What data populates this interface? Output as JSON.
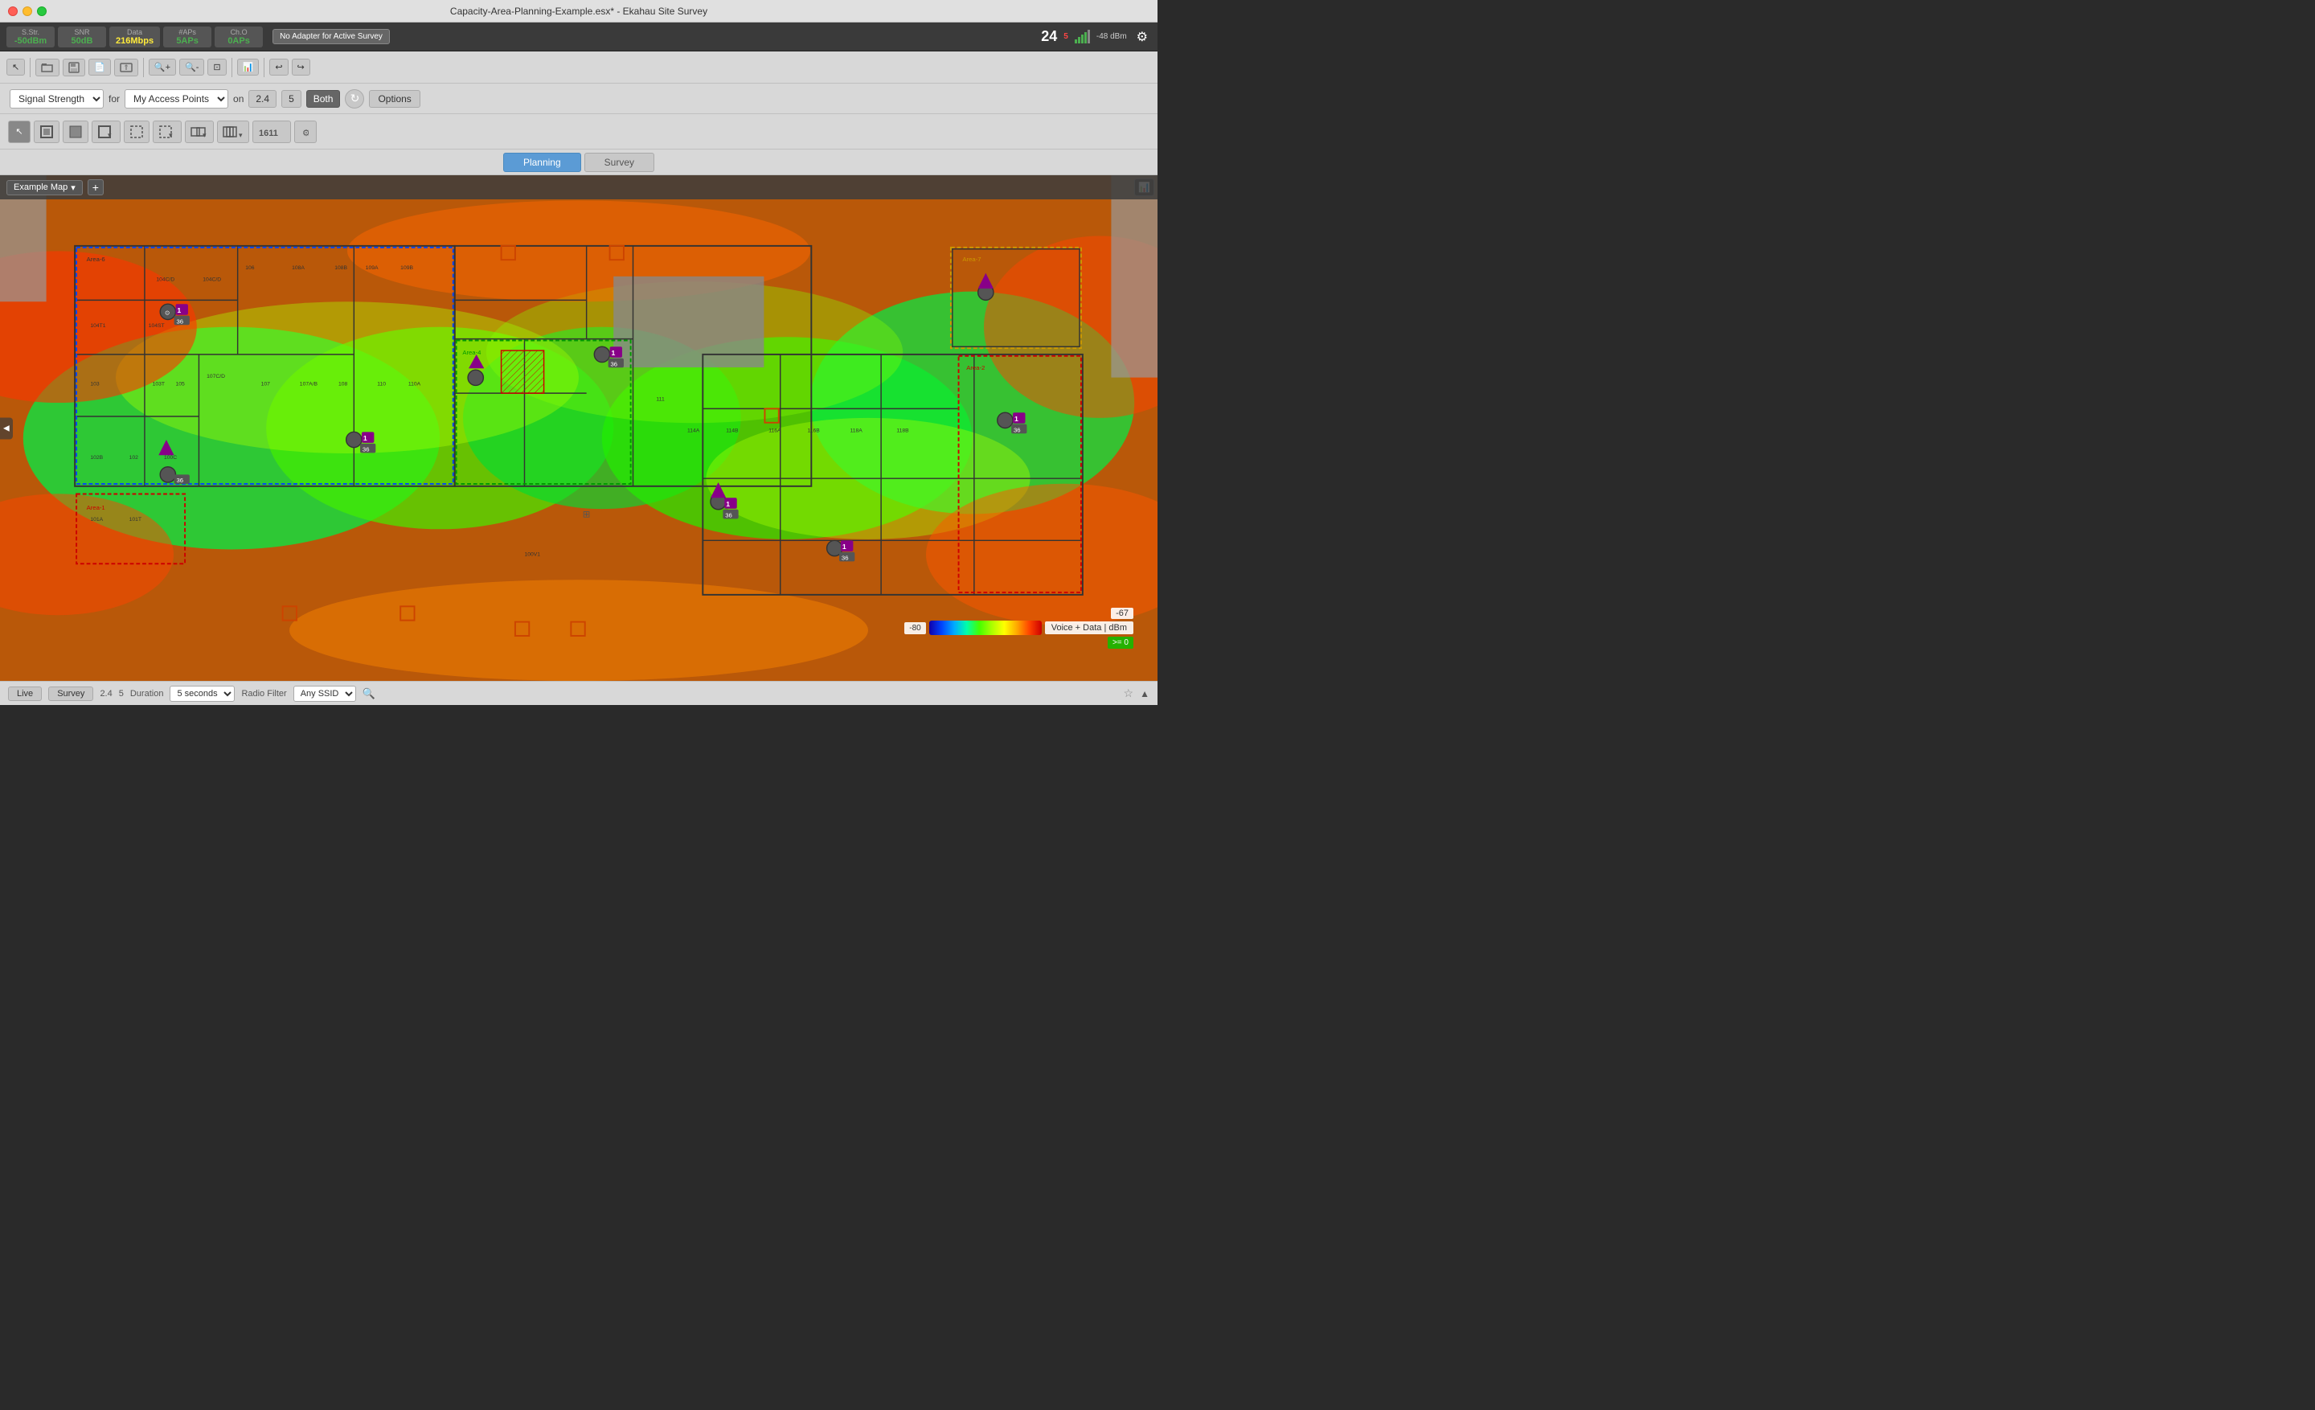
{
  "titlebar": {
    "title": "Capacity-Area-Planning-Example.esx* - Ekahau Site Survey",
    "icon": "■"
  },
  "statsbar": {
    "items": [
      {
        "label": "S.Str.",
        "value": "-50dBm",
        "color": "green"
      },
      {
        "label": "SNR",
        "value": "50dB",
        "color": "green"
      },
      {
        "label": "Data",
        "value": "216Mbps",
        "color": "yellow"
      },
      {
        "label": "#APs",
        "value": "5APs",
        "color": "green"
      },
      {
        "label": "Ch.O",
        "value": "0APs",
        "color": "green"
      }
    ],
    "no_adapter_label": "No Adapter for Active Survey",
    "signal_level": "-48 dBm",
    "signal_number": "24"
  },
  "filterbar": {
    "signal_type_label": "Signal Strength",
    "for_label": "for",
    "access_points_label": "My Access Points",
    "on_label": "on",
    "freq_24": "2.4",
    "freq_5": "5",
    "freq_both": "Both",
    "options_label": "Options",
    "active_freq": "Both"
  },
  "toolbar": {
    "undo_label": "↩",
    "redo_label": "↪",
    "open_label": "⊞",
    "save_label": "💾",
    "new_label": "📄",
    "import_label": "⇧"
  },
  "viewtabs": {
    "planning_label": "Planning",
    "survey_label": "Survey",
    "active": "Planning"
  },
  "map": {
    "name": "Example Map",
    "add_label": "+",
    "areas": [
      {
        "id": "area1",
        "label": "Area-1",
        "color": "#cc0000"
      },
      {
        "id": "area2",
        "label": "Area-2",
        "color": "#cc0000"
      },
      {
        "id": "area4",
        "label": "Area-4",
        "color": "#009900"
      },
      {
        "id": "area6",
        "label": "Area-6",
        "color": "#0000cc"
      },
      {
        "id": "area7",
        "label": "Area-7",
        "color": "#cc9900"
      }
    ]
  },
  "legend": {
    "value_67": "-67",
    "value_80": "-80",
    "label": "Voice + Data | dBm",
    "ge_label": ">= 0"
  },
  "bottombar": {
    "live_label": "Live",
    "survey_label": "Survey",
    "freq_24": "2.4",
    "freq_5": "5",
    "duration_label": "Duration",
    "duration_value": "5 seconds",
    "radio_filter_label": "Radio Filter",
    "radio_filter_placeholder": "Any SSID"
  },
  "drawtoolbar": {
    "cursor_label": "↖",
    "wall_labels": [
      "▦",
      "▩",
      "▦▾",
      "▣",
      "▢▾",
      "▢▦",
      "▢▢▾",
      "▦▦▦",
      "1611"
    ]
  }
}
